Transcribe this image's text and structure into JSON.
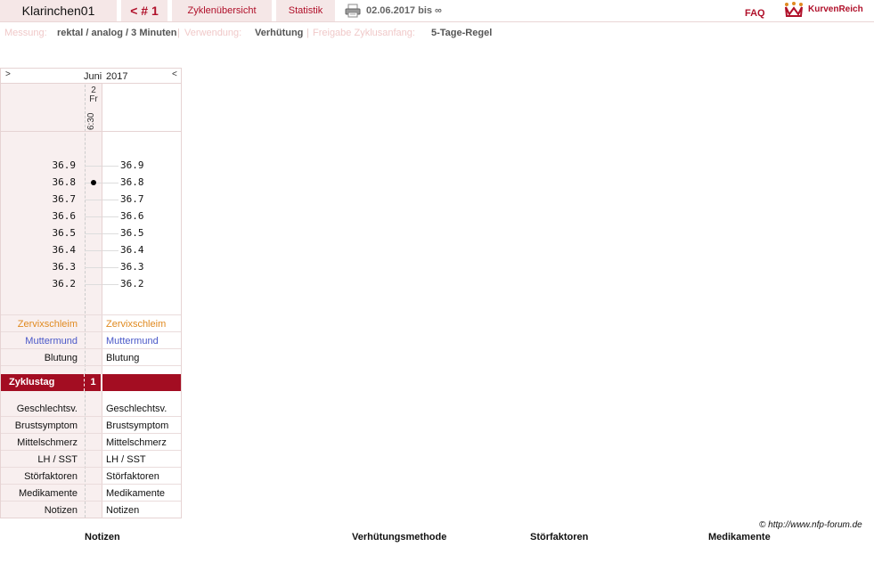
{
  "header": {
    "user": "Klarinchen01",
    "nav_prev": "< # 1",
    "tab_cycles": "Zyklenübersicht",
    "tab_stats": "Statistik",
    "date_range": "02.06.2017 bis ∞",
    "faq": "FAQ",
    "logo_text": "KurvenReich"
  },
  "info": {
    "measure_label": "Messung:",
    "measure_value": "rektal / analog / 3 Minuten",
    "use_label": "Verwendung:",
    "use_value": "Verhütung",
    "release_label": "Freigabe Zyklusanfang:",
    "release_value": "5-Tage-Regel",
    "separator": "|"
  },
  "chart": {
    "nav_next": ">",
    "nav_prev": "<",
    "month": "Juni",
    "year": "2017",
    "day": "2",
    "weekday": "Fr",
    "time": "6:30",
    "temps": [
      "36.9",
      "36.8",
      "36.7",
      "36.6",
      "36.5",
      "36.4",
      "36.3",
      "36.2"
    ],
    "measurement": 36.8,
    "rows_top": [
      {
        "label": "Zervixschleim",
        "cls": "c-zervix"
      },
      {
        "label": "Muttermund",
        "cls": "c-mutter"
      },
      {
        "label": "Blutung",
        "cls": ""
      }
    ],
    "cycle_label": "Zyklustag",
    "cycle_day": "1",
    "rows_bottom": [
      {
        "label": "Geschlechtsv."
      },
      {
        "label": "Brustsymptom"
      },
      {
        "label": "Mittelschmerz"
      },
      {
        "label": "LH / SST"
      },
      {
        "label": "Störfaktoren"
      },
      {
        "label": "Medikamente"
      },
      {
        "label": "Notizen"
      }
    ]
  },
  "footer": {
    "copyright": "© http://www.nfp-forum.de",
    "labels": [
      "Notizen",
      "Verhütungsmethode",
      "Störfaktoren",
      "Medikamente"
    ]
  },
  "colors": {
    "accent": "#b0102a",
    "cycle_bar": "#a30d22",
    "tab_bg": "#f5e7e7"
  }
}
